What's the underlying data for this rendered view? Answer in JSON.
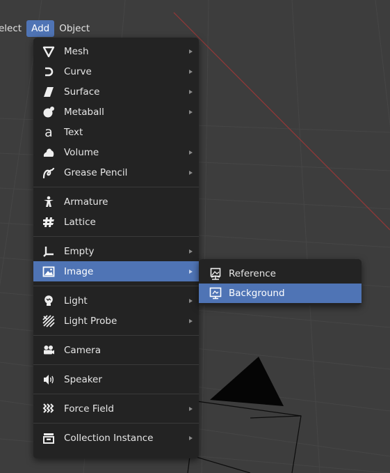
{
  "menubar": {
    "items": [
      {
        "label": "elect",
        "active": false
      },
      {
        "label": "Add",
        "active": true
      },
      {
        "label": "Object",
        "active": false
      }
    ]
  },
  "add_menu": {
    "items": [
      {
        "label": "Mesh",
        "icon": "mesh-icon",
        "submenu": true
      },
      {
        "label": "Curve",
        "icon": "curve-icon",
        "submenu": true
      },
      {
        "label": "Surface",
        "icon": "surface-icon",
        "submenu": true
      },
      {
        "label": "Metaball",
        "icon": "metaball-icon",
        "submenu": true
      },
      {
        "label": "Text",
        "icon": "text-icon",
        "submenu": false
      },
      {
        "label": "Volume",
        "icon": "volume-icon",
        "submenu": true
      },
      {
        "label": "Grease Pencil",
        "icon": "grease-pencil-icon",
        "submenu": true
      },
      {
        "label": "Armature",
        "icon": "armature-icon",
        "submenu": false
      },
      {
        "label": "Lattice",
        "icon": "lattice-icon",
        "submenu": false
      },
      {
        "label": "Empty",
        "icon": "empty-icon",
        "submenu": true
      },
      {
        "label": "Image",
        "icon": "image-icon",
        "submenu": true,
        "highlighted": true
      },
      {
        "label": "Light",
        "icon": "light-icon",
        "submenu": true
      },
      {
        "label": "Light Probe",
        "icon": "light-probe-icon",
        "submenu": true
      },
      {
        "label": "Camera",
        "icon": "camera-icon",
        "submenu": false
      },
      {
        "label": "Speaker",
        "icon": "speaker-icon",
        "submenu": false
      },
      {
        "label": "Force Field",
        "icon": "force-field-icon",
        "submenu": true
      },
      {
        "label": "Collection Instance",
        "icon": "collection-instance-icon",
        "submenu": true
      }
    ]
  },
  "image_submenu": {
    "items": [
      {
        "label": "Reference",
        "icon": "image-reference-icon",
        "highlighted": false
      },
      {
        "label": "Background",
        "icon": "image-background-icon",
        "highlighted": true
      }
    ]
  },
  "colors": {
    "highlight": "#4f74b5",
    "menu_bg": "#232323",
    "viewport_bg": "#3d3d3d",
    "x_axis": "#8f3838"
  }
}
